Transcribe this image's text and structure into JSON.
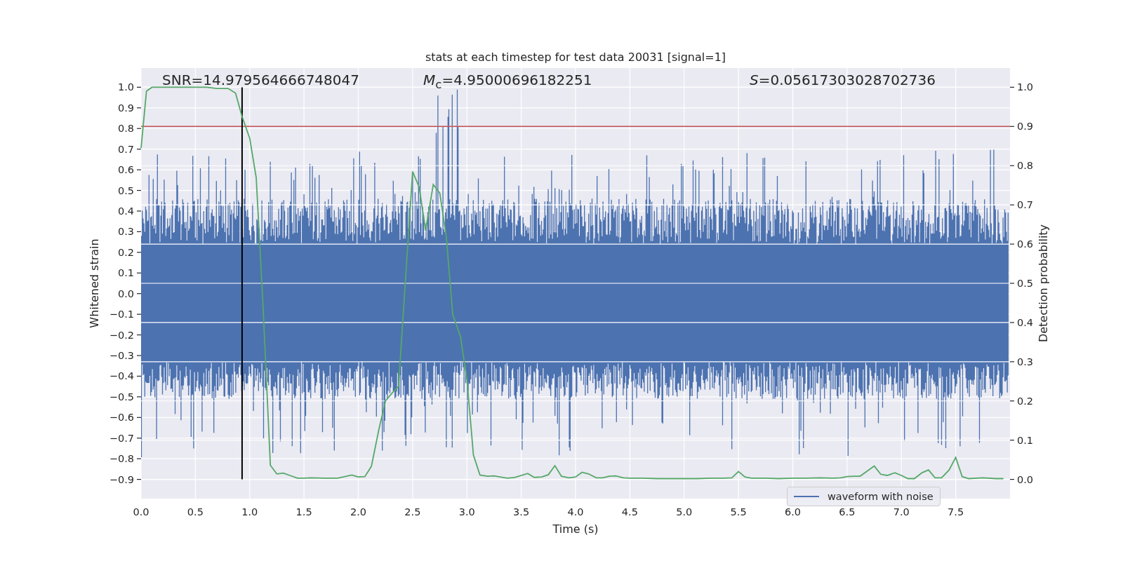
{
  "figure": {
    "stats": [
      "SNR=14.979564666748047",
      "*M*$_{c}$=4.95000696182251",
      "*S*=0.05617303028702736"
    ],
    "legend": [
      {
        "label": "waveform with noise",
        "color": "#4c72b0"
      }
    ],
    "chart_data": {
      "type": "line",
      "title": "stats at each timestep for test data 20031 [signal=1]",
      "xlabel": "Time (s)",
      "ylabel": "Whitened strain",
      "y2label": "Detection probability",
      "xlim": [
        0,
        8
      ],
      "ylim": [
        -0.993,
        1.093
      ],
      "y2lim": [
        -0.049,
        1.049
      ],
      "xticks": [
        {
          "value": 0,
          "label": "0.0"
        },
        {
          "value": 0.5,
          "label": "0.5"
        },
        {
          "value": 1,
          "label": "1.0"
        },
        {
          "value": 1.5,
          "label": "1.5"
        },
        {
          "value": 2,
          "label": "2.0"
        },
        {
          "value": 2.5,
          "label": "2.5"
        },
        {
          "value": 3,
          "label": "3.0"
        },
        {
          "value": 3.5,
          "label": "3.5"
        },
        {
          "value": 4,
          "label": "4.0"
        },
        {
          "value": 4.5,
          "label": "4.5"
        },
        {
          "value": 5,
          "label": "5.0"
        },
        {
          "value": 5.5,
          "label": "5.5"
        },
        {
          "value": 6,
          "label": "6.0"
        },
        {
          "value": 6.5,
          "label": "6.5"
        },
        {
          "value": 7,
          "label": "7.0"
        },
        {
          "value": 7.5,
          "label": "7.5"
        }
      ],
      "yticks": [
        {
          "value": 1,
          "label": "1.0"
        },
        {
          "value": 0.9,
          "label": "0.9"
        },
        {
          "value": 0.8,
          "label": "0.8"
        },
        {
          "value": 0.7,
          "label": "0.7"
        },
        {
          "value": 0.6,
          "label": "0.6"
        },
        {
          "value": 0.5,
          "label": "0.5"
        },
        {
          "value": 0.4,
          "label": "0.4"
        },
        {
          "value": 0.3,
          "label": "0.3"
        },
        {
          "value": 0.2,
          "label": "0.2"
        },
        {
          "value": 0.1,
          "label": "0.1"
        },
        {
          "value": 0,
          "label": "0.0"
        },
        {
          "value": -0.1,
          "label": "−0.1"
        },
        {
          "value": -0.2,
          "label": "−0.2"
        },
        {
          "value": -0.3,
          "label": "−0.3"
        },
        {
          "value": -0.4,
          "label": "−0.4"
        },
        {
          "value": -0.5,
          "label": "−0.5"
        },
        {
          "value": -0.6,
          "label": "−0.6"
        },
        {
          "value": -0.7,
          "label": "−0.7"
        },
        {
          "value": -0.8,
          "label": "−0.8"
        },
        {
          "value": -0.9,
          "label": "−0.9"
        }
      ],
      "y2ticks": [
        {
          "value": 1,
          "label": "1.0"
        },
        {
          "value": 0.9,
          "label": "0.9"
        },
        {
          "value": 0.8,
          "label": "0.8"
        },
        {
          "value": 0.7,
          "label": "0.7"
        },
        {
          "value": 0.6,
          "label": "0.6"
        },
        {
          "value": 0.5,
          "label": "0.5"
        },
        {
          "value": 0.4,
          "label": "0.4"
        },
        {
          "value": 0.3,
          "label": "0.3"
        },
        {
          "value": 0.2,
          "label": "0.2"
        },
        {
          "value": 0.1,
          "label": "0.1"
        },
        {
          "value": 0,
          "label": "0.0"
        }
      ],
      "x": [
        0,
        0.05,
        0.1,
        0.2,
        0.4,
        0.6,
        0.7,
        0.8,
        0.87,
        0.93,
        1.0,
        1.06,
        1.12,
        1.19,
        1.25,
        1.31,
        1.37,
        1.44,
        1.5,
        1.56,
        1.69,
        1.81,
        1.94,
        2.0,
        2.06,
        2.12,
        2.19,
        2.25,
        2.31,
        2.37,
        2.43,
        2.5,
        2.56,
        2.62,
        2.69,
        2.75,
        2.81,
        2.87,
        2.94,
        3.0,
        3.06,
        3.12,
        3.19,
        3.25,
        3.37,
        3.44,
        3.56,
        3.62,
        3.69,
        3.75,
        3.81,
        3.87,
        3.94,
        4.0,
        4.06,
        4.12,
        4.19,
        4.25,
        4.31,
        4.37,
        4.44,
        4.5,
        4.62,
        4.75,
        4.87,
        5.0,
        5.12,
        5.25,
        5.37,
        5.44,
        5.5,
        5.56,
        5.62,
        5.75,
        5.87,
        6.0,
        6.12,
        6.25,
        6.37,
        6.44,
        6.5,
        6.56,
        6.62,
        6.69,
        6.75,
        6.81,
        6.87,
        6.94,
        7.0,
        7.06,
        7.12,
        7.19,
        7.25,
        7.31,
        7.37,
        7.44,
        7.5,
        7.56,
        7.62,
        7.75,
        7.87,
        7.94
      ],
      "series": [
        {
          "color": "#55a868",
          "axis": "y2",
          "values": [
            0.845,
            0.99,
            1.0,
            1.0,
            1.0,
            1.0,
            0.997,
            0.997,
            0.985,
            0.925,
            0.87,
            0.77,
            0.46,
            0.036,
            0.014,
            0.016,
            0.01,
            0.003,
            0.003,
            0.004,
            0.003,
            0.003,
            0.011,
            0.006,
            0.007,
            0.033,
            0.128,
            0.2,
            0.22,
            0.237,
            0.49,
            0.785,
            0.745,
            0.635,
            0.752,
            0.73,
            0.62,
            0.42,
            0.365,
            0.255,
            0.062,
            0.011,
            0.008,
            0.009,
            0.003,
            0.005,
            0.015,
            0.005,
            0.006,
            0.012,
            0.035,
            0.008,
            0.004,
            0.006,
            0.018,
            0.014,
            0.004,
            0.004,
            0.008,
            0.009,
            0.004,
            0.003,
            0.003,
            0.002,
            0.002,
            0.002,
            0.002,
            0.003,
            0.003,
            0.004,
            0.02,
            0.006,
            0.003,
            0.003,
            0.002,
            0.003,
            0.003,
            0.004,
            0.003,
            0.004,
            0.007,
            0.008,
            0.008,
            0.022,
            0.034,
            0.013,
            0.01,
            0.017,
            0.01,
            0.002,
            0.002,
            0.017,
            0.024,
            0.004,
            0.004,
            0.024,
            0.056,
            0.007,
            0.002,
            0.004,
            0.002,
            0.002
          ]
        }
      ],
      "grid": true,
      "ref_lines": [
        {
          "axis": "y",
          "value": 0.81,
          "color": "#c44e52"
        },
        {
          "axis": "x",
          "value": 0.93,
          "color": "#000000"
        }
      ]
    }
  }
}
